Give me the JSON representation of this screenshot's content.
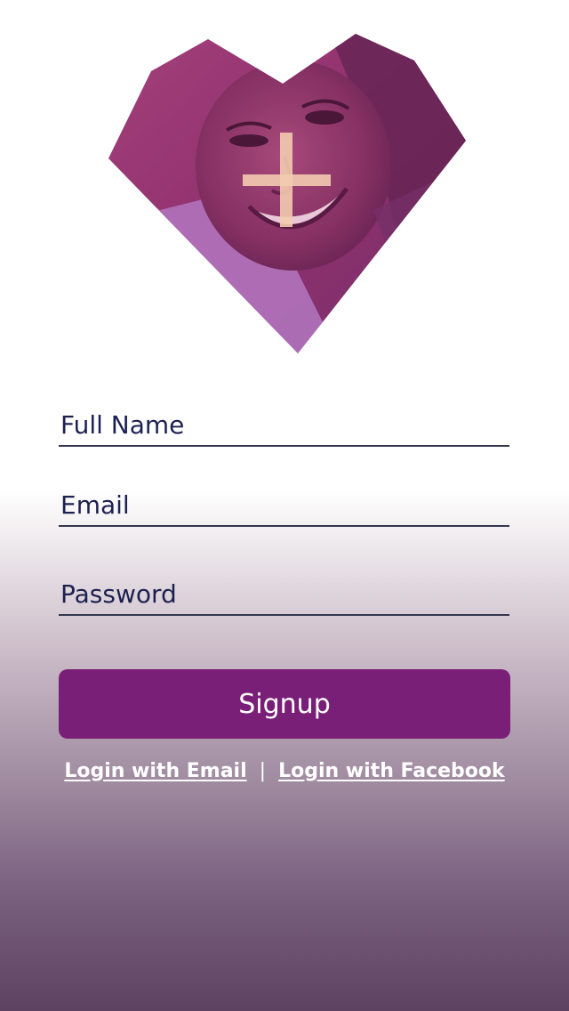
{
  "avatar": {
    "overlay_color": "#8a2a6e",
    "plus_color": "#f2cbb0",
    "icon": "plus-icon"
  },
  "form": {
    "full_name_placeholder": "Full Name",
    "email_placeholder": "Email",
    "password_placeholder": "Password"
  },
  "signup_label": "Signup",
  "login_links": {
    "email_label": "Login with Email",
    "separator": "|",
    "facebook_label": "Login with Facebook"
  },
  "colors": {
    "accent": "#7a1f77",
    "text_dark": "#1d2150",
    "underline": "#34364f"
  }
}
